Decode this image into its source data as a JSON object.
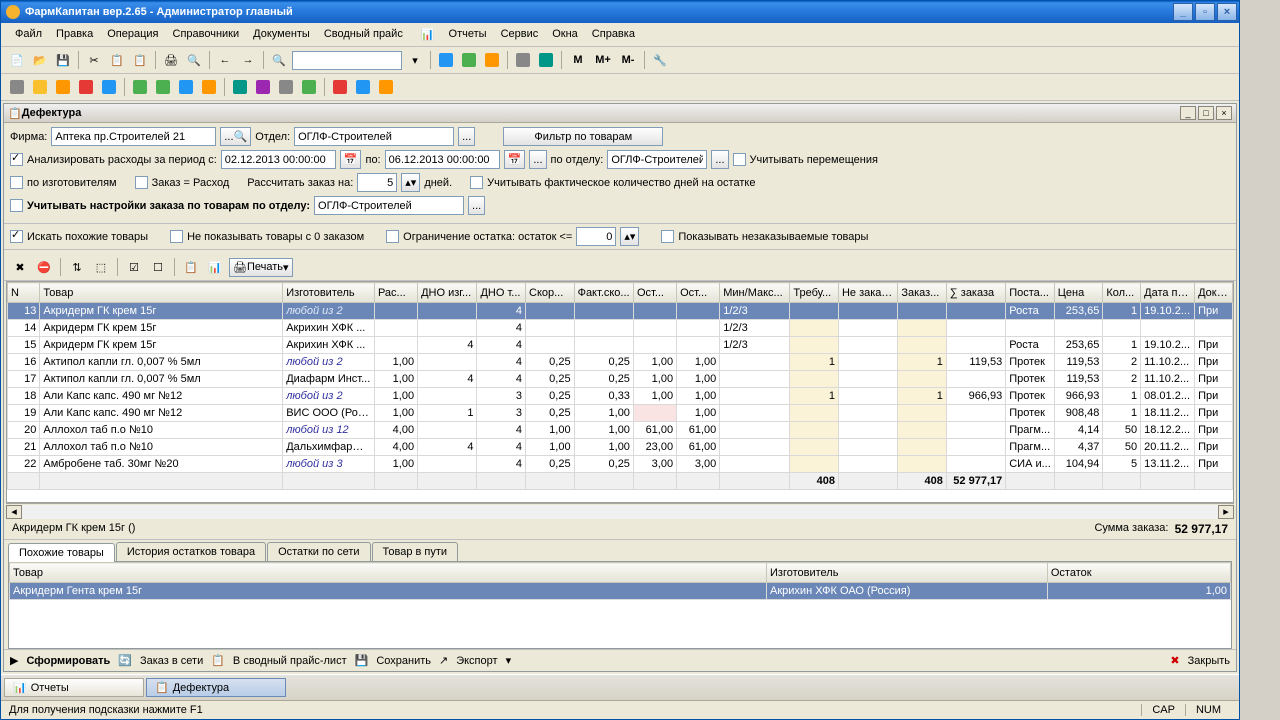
{
  "title": "ФармКапитан вер.2.65 - Администратор главный",
  "menu": [
    "Файл",
    "Правка",
    "Операция",
    "Справочники",
    "Документы",
    "Сводный прайс",
    "Отчеты",
    "Сервис",
    "Окна",
    "Справка"
  ],
  "sub": {
    "title": "Дефектура"
  },
  "filters": {
    "firma_label": "Фирма:",
    "firma": "Аптека пр.Строителей 21",
    "otdel_label": "Отдел:",
    "otdel": "ОГЛФ-Строителей",
    "filter_btn": "Фильтр по товарам",
    "analyze": "Анализировать расходы за период с:",
    "date_from": "02.12.2013 00:00:00",
    "date_to_lbl": "по:",
    "date_to": "06.12.2013 00:00:00",
    "po_otdelu": "по отделу:",
    "otdel2": "ОГЛФ-Строителей",
    "uchit_perem": "Учитывать перемещения",
    "po_izgot": "по изготовителям",
    "zakaz_eq": "Заказ = Расход",
    "rasschitat": "Рассчитать заказ на:",
    "days_val": "5",
    "days": "дней.",
    "uchit_fakt": "Учитывать фактическое количество дней на остатке",
    "uchit_nast": "Учитывать настройки заказа по товарам по отделу:",
    "otdel3": "ОГЛФ-Строителей",
    "iskat": "Искать похожие товары",
    "ne_pokaz": "Не показывать товары с 0 заказом",
    "ogran": "Ограничение остатка:  остаток <=",
    "ogran_val": "0",
    "pokaz_nez": "Показывать незаказываемые товары",
    "print": "Печать"
  },
  "cols": [
    "N",
    "Товар",
    "Изготовитель",
    "Рас...",
    "ДНО изг...",
    "ДНО т...",
    "Скор...",
    "Факт.ско...",
    "Ост...",
    "Ост...",
    "Мин/Макс...",
    "Требу...",
    "Не заказ...",
    "Заказ...",
    "∑ заказа",
    "Поста...",
    "Цена",
    "Кол...",
    "Дата пр...",
    "Доку..."
  ],
  "rows": [
    {
      "n": "13",
      "t": "Акридерм ГК крем 15г",
      "m": "любой из 2",
      "ital": true,
      "r": "",
      "d1": "",
      "d2": "4",
      "s": "",
      "fs": "",
      "o1": "",
      "o2": "",
      "mm": "1/2/3",
      "tr": "",
      "nz": "",
      "z": "",
      "sz": "",
      "p": "Роста",
      "c": "253,65",
      "k": "1",
      "dp": "19.10.2...",
      "dk": "При",
      "sel": true
    },
    {
      "n": "14",
      "t": "Акридерм ГК крем 15г",
      "m": "Акрихин ХФК ...",
      "r": "",
      "d1": "",
      "d2": "4",
      "s": "",
      "fs": "",
      "o1": "",
      "o2": "",
      "mm": "1/2/3",
      "tr": "",
      "nz": "",
      "z": "",
      "sz": "",
      "p": "",
      "c": "",
      "k": "",
      "dp": "",
      "dk": ""
    },
    {
      "n": "15",
      "t": "Акридерм ГК крем 15г",
      "m": "Акрихин ХФК ...",
      "r": "",
      "d1": "4",
      "d2": "4",
      "s": "",
      "fs": "",
      "o1": "",
      "o2": "",
      "mm": "1/2/3",
      "tr": "",
      "nz": "",
      "z": "",
      "sz": "",
      "p": "Роста",
      "c": "253,65",
      "k": "1",
      "dp": "19.10.2...",
      "dk": "При"
    },
    {
      "n": "16",
      "t": "Актипол капли гл. 0,007 % 5мл",
      "m": "любой из 2",
      "ital": true,
      "r": "1,00",
      "d1": "",
      "d2": "4",
      "s": "0,25",
      "fs": "0,25",
      "o1": "1,00",
      "o2": "1,00",
      "mm": "",
      "tr": "1",
      "nz": "",
      "z": "1",
      "sz": "119,53",
      "p": "Протек",
      "c": "119,53",
      "k": "2",
      "dp": "11.10.2...",
      "dk": "При"
    },
    {
      "n": "17",
      "t": "Актипол капли гл. 0,007 % 5мл",
      "m": "Диафарм Инст...",
      "r": "1,00",
      "d1": "4",
      "d2": "4",
      "s": "0,25",
      "fs": "0,25",
      "o1": "1,00",
      "o2": "1,00",
      "mm": "",
      "tr": "",
      "nz": "",
      "z": "",
      "sz": "",
      "p": "Протек",
      "c": "119,53",
      "k": "2",
      "dp": "11.10.2...",
      "dk": "При"
    },
    {
      "n": "18",
      "t": "Али  Капс капс. 490 мг №12",
      "m": "любой из 2",
      "ital": true,
      "r": "1,00",
      "d1": "",
      "d2": "3",
      "s": "0,25",
      "fs": "0,33",
      "o1": "1,00",
      "o2": "1,00",
      "mm": "",
      "tr": "1",
      "nz": "",
      "z": "1",
      "sz": "966,93",
      "p": "Протек",
      "c": "966,93",
      "k": "1",
      "dp": "08.01.2...",
      "dk": "При"
    },
    {
      "n": "19",
      "t": "Али  Капс капс. 490 мг №12",
      "m": "ВИС ООО (Рос...",
      "r": "1,00",
      "d1": "1",
      "d2": "3",
      "s": "0,25",
      "fs": "1,00",
      "o1": "",
      "o2": "1,00",
      "mm": "",
      "tr": "",
      "nz": "",
      "z": "",
      "sz": "",
      "p": "Протек",
      "c": "908,48",
      "k": "1",
      "dp": "18.11.2...",
      "dk": "При",
      "pink1": true
    },
    {
      "n": "20",
      "t": "Аллохол таб п.о №10",
      "m": "любой из 12",
      "ital": true,
      "r": "4,00",
      "d1": "",
      "d2": "4",
      "s": "1,00",
      "fs": "1,00",
      "o1": "61,00",
      "o2": "61,00",
      "mm": "",
      "tr": "",
      "nz": "",
      "z": "",
      "sz": "",
      "p": "Прагм...",
      "c": "4,14",
      "k": "50",
      "dp": "18.12.2...",
      "dk": "При"
    },
    {
      "n": "21",
      "t": "Аллохол таб п.о №10",
      "m": "Дальхимфарм ...",
      "r": "4,00",
      "d1": "4",
      "d2": "4",
      "s": "1,00",
      "fs": "1,00",
      "o1": "23,00",
      "o2": "61,00",
      "mm": "",
      "tr": "",
      "nz": "",
      "z": "",
      "sz": "",
      "p": "Прагм...",
      "c": "4,37",
      "k": "50",
      "dp": "20.11.2...",
      "dk": "При"
    },
    {
      "n": "22",
      "t": "Амбробене таб. 30мг №20",
      "m": "любой из 3",
      "ital": true,
      "r": "1,00",
      "d1": "",
      "d2": "4",
      "s": "0,25",
      "fs": "0,25",
      "o1": "3,00",
      "o2": "3,00",
      "mm": "",
      "tr": "",
      "nz": "",
      "z": "",
      "sz": "",
      "p": "СИА и...",
      "c": "104,94",
      "k": "5",
      "dp": "13.11.2...",
      "dk": "При"
    }
  ],
  "totals": {
    "tr": "408",
    "z": "408",
    "sz": "52 977,17"
  },
  "selected_item": "Акридерм ГК крем 15г ()",
  "sum_label": "Сумма заказа:",
  "sum": "52 977,17",
  "tabs": [
    "Похожие товары",
    "История остатков товара",
    "Остатки по сети",
    "Товар в пути"
  ],
  "sub_cols": [
    "Товар",
    "Изготовитель",
    "Остаток"
  ],
  "sub_row": {
    "t": "Акридерм Гента крем 15г",
    "m": "Акрихин ХФК ОАО (Россия)",
    "o": "1,00"
  },
  "bbar": {
    "form": "Сформировать",
    "net": "Заказ в сети",
    "svod": "В сводный прайс-лист",
    "save": "Сохранить",
    "export": "Экспорт",
    "close": "Закрыть"
  },
  "tasks": [
    "Отчеты",
    "Дефектура"
  ],
  "hint": "Для получения подсказки нажмите F1",
  "cap": "CAP",
  "num": "NUM"
}
